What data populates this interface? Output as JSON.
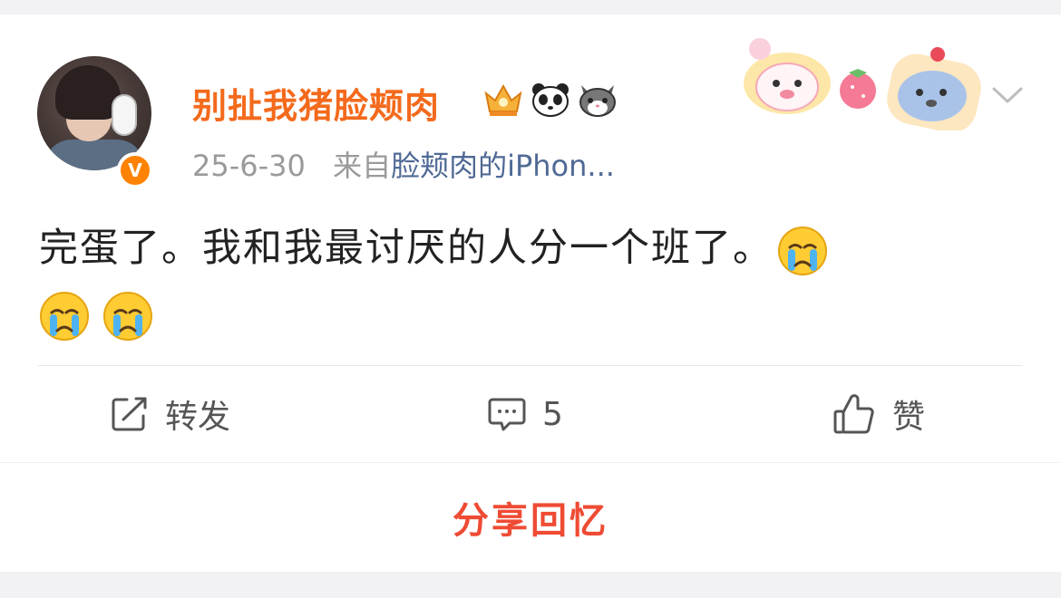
{
  "post": {
    "user": {
      "name": "别扯我猪脸颊肉",
      "avatar": "avatar",
      "verified_icon": "verified-badge",
      "verified_mark": "V"
    },
    "badges": [
      "crown-badge-icon",
      "panda-icon",
      "cat-icon"
    ],
    "date": "25-6-30",
    "source_prefix": "来自",
    "source": "脸颊肉的iPhon...",
    "text": "完蛋了。我和我最讨厌的人分一个班了。",
    "emojis": [
      "crying-emoji-icon",
      "crying-emoji-icon",
      "crying-emoji-icon"
    ],
    "actions": {
      "repost_label": "转发",
      "comment_count": "5",
      "like_label": "赞"
    }
  },
  "share": {
    "label": "分享回忆"
  },
  "colors": {
    "username": "#f46a1c",
    "share": "#ef4b34",
    "source_link": "#506a96",
    "meta": "#9a9a9a",
    "verified": "#ff8200"
  }
}
